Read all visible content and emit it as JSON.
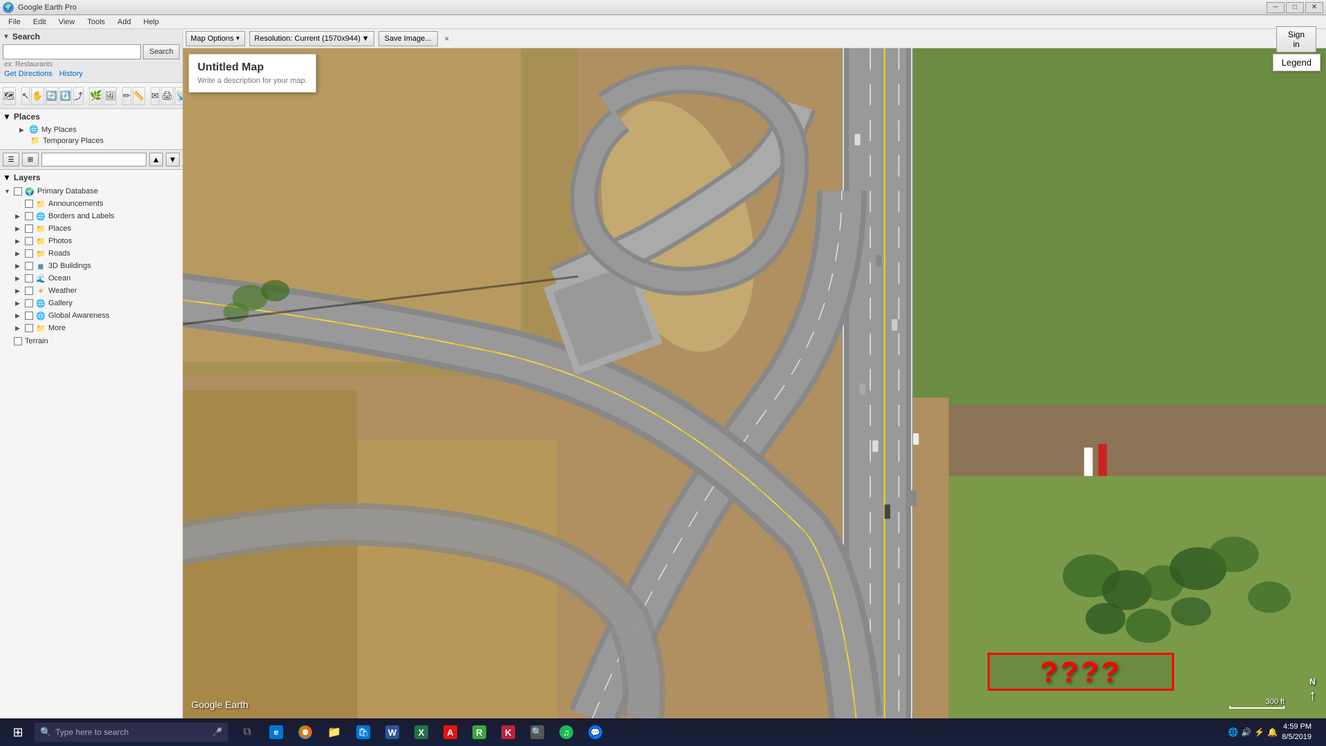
{
  "app": {
    "title": "Google Earth Pro",
    "icon": "🌍"
  },
  "title_bar": {
    "title": "Google Earth Pro",
    "minimize": "─",
    "maximize": "□",
    "close": "✕"
  },
  "menu": {
    "items": [
      "File",
      "Edit",
      "View",
      "Tools",
      "Add",
      "Help"
    ]
  },
  "search": {
    "section_label": "Search",
    "input_placeholder": "",
    "search_button": "Search",
    "hint": "ex: Restaurants",
    "get_directions": "Get Directions",
    "history": "History"
  },
  "map_toolbar": {
    "map_options": "Map Options",
    "resolution": "Resolution: Current (1570x944)",
    "save_image": "Save Image...",
    "close": "×"
  },
  "map_popup": {
    "title": "Untitled Map",
    "description": "Write a description for your map."
  },
  "legend_btn": "Legend",
  "google_earth_watermark": "Google Earth",
  "scale": {
    "label": "300 ft"
  },
  "compass": {
    "n_label": "N"
  },
  "question_marks": "????",
  "sign_in": "Sign in",
  "places": {
    "section_label": "Places",
    "items": [
      {
        "label": "My Places",
        "type": "globe",
        "expanded": false
      },
      {
        "label": "Temporary Places",
        "type": "folder",
        "expanded": false
      }
    ]
  },
  "layers": {
    "section_label": "Layers",
    "items": [
      {
        "label": "Primary Database",
        "expanded": true,
        "checked": false,
        "icon": "globe",
        "children": [
          {
            "label": "Announcements",
            "checked": false,
            "icon": "folder"
          },
          {
            "label": "Borders and Labels",
            "checked": false,
            "icon": "globe2",
            "expandable": true
          },
          {
            "label": "Places",
            "checked": false,
            "icon": "folder",
            "expandable": true
          },
          {
            "label": "Photos",
            "checked": false,
            "icon": "folder",
            "expandable": true
          },
          {
            "label": "Roads",
            "checked": false,
            "icon": "folder",
            "expandable": true
          },
          {
            "label": "3D Buildings",
            "checked": false,
            "icon": "cube",
            "expandable": true
          },
          {
            "label": "Ocean",
            "checked": false,
            "icon": "wave",
            "expandable": true
          },
          {
            "label": "Weather",
            "checked": false,
            "icon": "sun",
            "expandable": true
          },
          {
            "label": "Gallery",
            "checked": false,
            "icon": "globe3",
            "expandable": true
          },
          {
            "label": "Global Awareness",
            "checked": false,
            "icon": "globe4",
            "expandable": true
          },
          {
            "label": "More",
            "checked": false,
            "icon": "folder2",
            "expandable": true
          }
        ]
      }
    ],
    "terrain": {
      "label": "Terrain",
      "checked": false
    }
  },
  "toolbar": {
    "buttons": [
      "🔲",
      "↖",
      "↗",
      "🔄",
      "🔃",
      "⤴",
      "⤵",
      "🌿",
      "🖼",
      "✏",
      "📏",
      "📧",
      "📸",
      "📡",
      "🔭"
    ]
  },
  "taskbar": {
    "start_icon": "⊞",
    "search_placeholder": "Type here to search",
    "search_icon": "🔍",
    "apps": [
      {
        "name": "task-view",
        "icon": "⧉",
        "color": "#666"
      },
      {
        "name": "edge",
        "icon": "e",
        "color": "#0078d7"
      },
      {
        "name": "chrome",
        "icon": "◉",
        "color": "#e37400"
      },
      {
        "name": "file-explorer",
        "icon": "📁",
        "color": "#ffc000"
      },
      {
        "name": "windows-store",
        "icon": "🛍",
        "color": "#0078d7"
      },
      {
        "name": "word",
        "icon": "W",
        "color": "#2b579a"
      },
      {
        "name": "excel",
        "icon": "X",
        "color": "#217346"
      },
      {
        "name": "acrobat",
        "icon": "A",
        "color": "#ee1111"
      },
      {
        "name": "autohotkey",
        "icon": "R",
        "color": "#3da63d"
      },
      {
        "name": "app-k",
        "icon": "K",
        "color": "#c41f3b"
      },
      {
        "name": "search-btn",
        "icon": "🔍",
        "color": "#555"
      },
      {
        "name": "spotify",
        "icon": "♫",
        "color": "#1db954"
      },
      {
        "name": "messenger",
        "icon": "💬",
        "color": "#0078ff"
      }
    ],
    "time": "4:59 PM",
    "date": "8/5/2019"
  }
}
